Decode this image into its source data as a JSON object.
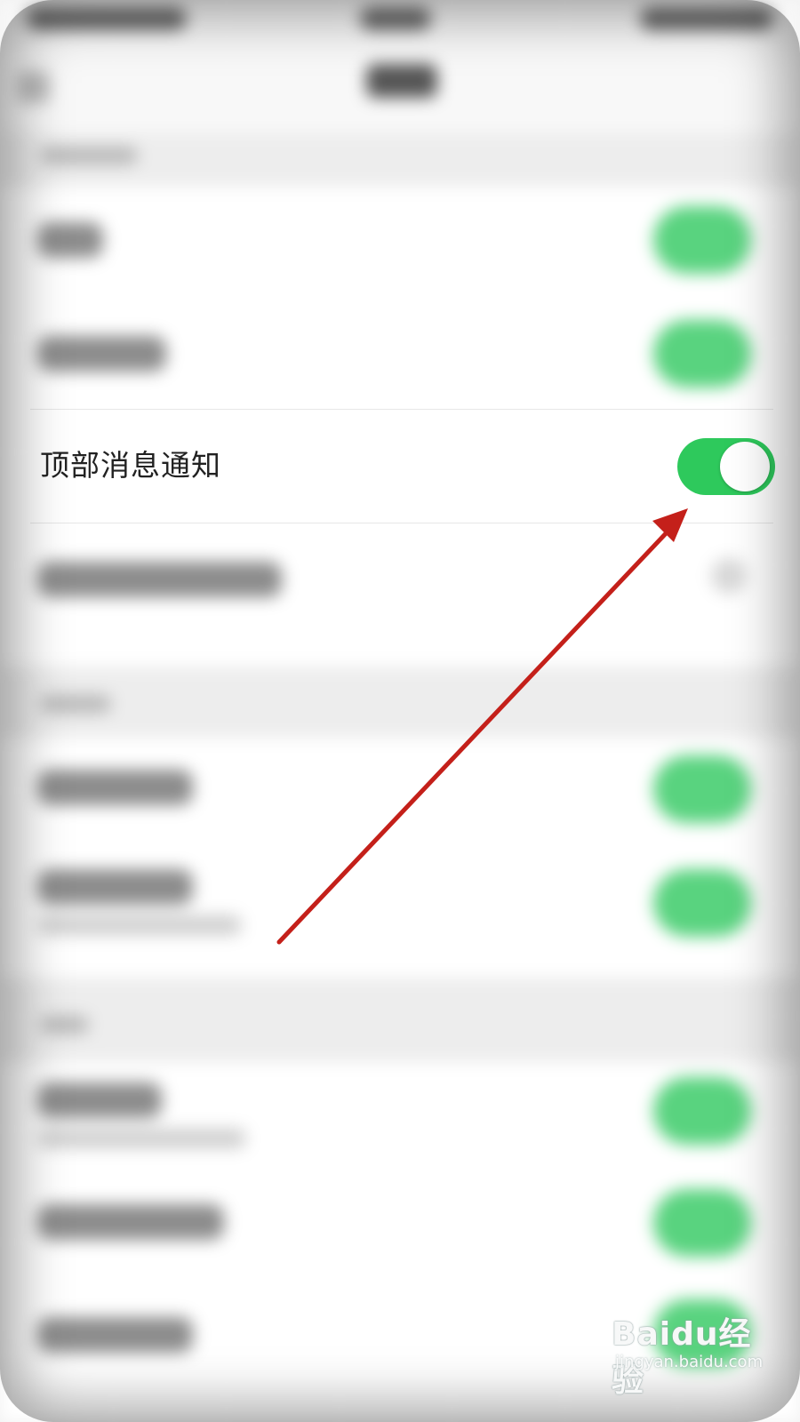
{
  "focused_setting": {
    "label": "顶部消息通知",
    "toggle_state": "on"
  },
  "colors": {
    "toggle_on": "#2ec95c",
    "arrow": "#c4201a"
  },
  "watermark": {
    "brand": "Baidu经验",
    "url": "jingyan.baidu.com"
  }
}
